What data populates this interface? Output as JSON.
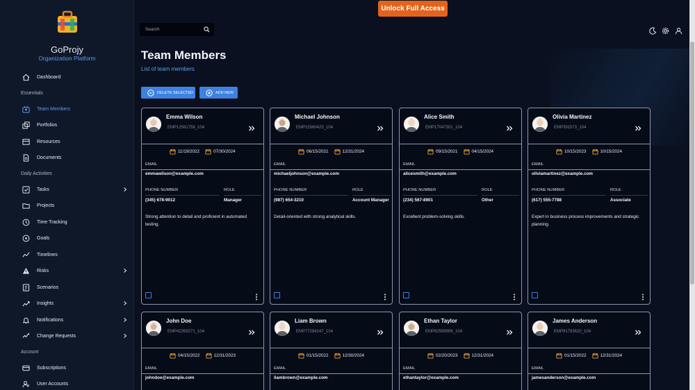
{
  "brand": {
    "name": "GoProjy",
    "subtitle": "Organization Platform"
  },
  "nav": {
    "dashboard": "Dashboard",
    "section_essentials": "Essentials",
    "team_members": "Team Members",
    "portfolios": "Portfolios",
    "resources": "Resources",
    "documents": "Documents",
    "section_daily": "Daily Activities",
    "tasks": "Tasks",
    "projects": "Projects",
    "time_tracking": "Time Tracking",
    "goals": "Goals",
    "timelines": "Timelines",
    "risks": "Risks",
    "scenarios": "Scenarios",
    "insights": "Insights",
    "notifications": "Notifications",
    "change_requests": "Change Requests",
    "section_account": "Account",
    "subscriptions": "Subscriptions",
    "user_accounts": "User Accounts"
  },
  "topbar": {
    "unlock_label": "Unlock Full Access",
    "search_placeholder": "Search",
    "icons": [
      "moon-icon",
      "gear-icon",
      "user-icon"
    ]
  },
  "page": {
    "title": "Team Members",
    "subtitle": "List of team members"
  },
  "actions": {
    "delete_selected": "DELETE SELECTED",
    "add_new": "ADD NEW"
  },
  "labels": {
    "email": "EMAIL",
    "phone": "PHONE NUMBER",
    "role": "ROLE"
  },
  "colors": {
    "accent": "#3d82e0",
    "unlock": "#e4631c",
    "active_nav": "#5b9bf0"
  },
  "members": [
    {
      "name": "Emma Wilson",
      "emp": "EMP12561758_104",
      "start": "11/19/2022",
      "end": "07/30/2024",
      "email": "emmawilson@example.com",
      "phone": "(345) 678-9012",
      "role": "Manager",
      "desc": "Strong attention to detail and proficient in automated testing."
    },
    {
      "name": "Michael Johnson",
      "emp": "EMP15360423_104",
      "start": "06/15/2021",
      "end": "12/31/2024",
      "email": "michaeljohnson@example.com",
      "phone": "(987) 654-3210",
      "role": "Account Manager",
      "desc": "Detail-oriented with strong analytical skills."
    },
    {
      "name": "Alice Smith",
      "emp": "EMP17047301_104",
      "start": "09/15/2021",
      "end": "04/15/2024",
      "email": "alicesmith@example.com",
      "phone": "(234) 567-8901",
      "role": "Other",
      "desc": "Excellent problem-solving skills."
    },
    {
      "name": "Olivia Martinez",
      "emp": "EMP391573_104",
      "start": "10/15/2023",
      "end": "10/15/2024",
      "email": "oliviamartinez@example.com",
      "phone": "(617) 555-7788",
      "role": "Associate",
      "desc": "Expert in business process improvements and strategic planning."
    },
    {
      "name": "John Doe",
      "emp": "EMP42399271_104",
      "start": "04/15/2022",
      "end": "12/31/2023",
      "email": "johndoe@example.com"
    },
    {
      "name": "Liam Brown",
      "emp": "EMP77284247_104",
      "start": "01/15/2022",
      "end": "12/30/2024",
      "email": "liambrown@example.com"
    },
    {
      "name": "Ethan Taylor",
      "emp": "EMP82589999_104",
      "start": "02/20/2023",
      "end": "12/31/2024",
      "email": "ethantaylor@example.com"
    },
    {
      "name": "James Anderson",
      "emp": "EMP91793620_104",
      "start": "01/15/2022",
      "end": "12/31/2024",
      "email": "jamesanderson@example.com"
    }
  ]
}
